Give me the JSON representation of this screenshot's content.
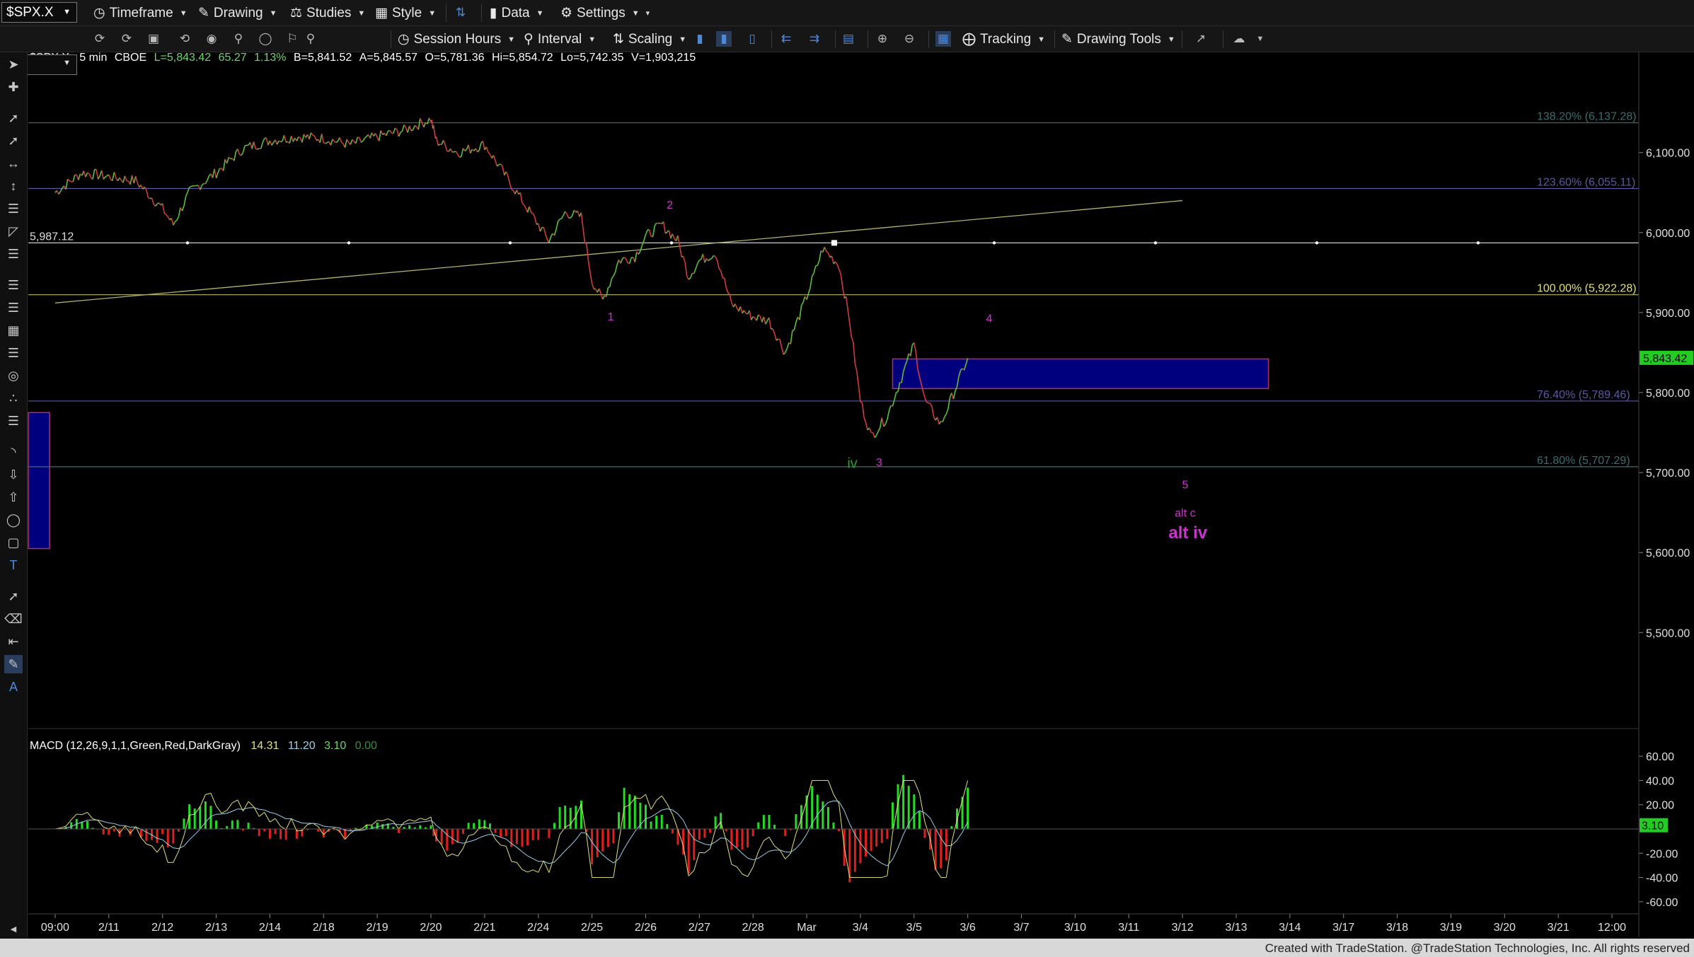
{
  "toolbar": {
    "symbol": "$SPX.X",
    "timeframe": "Timeframe",
    "drawing": "Drawing",
    "studies": "Studies",
    "style": "Style",
    "data": "Data",
    "settings": "Settings",
    "session_hours": "Session Hours",
    "interval": "Interval",
    "scaling": "Scaling",
    "tracking": "Tracking",
    "drawing_tools": "Drawing Tools"
  },
  "header": {
    "symbol_desc": "$SPX.X - 5 min",
    "exchange": "CBOE",
    "last": "L=5,843.42",
    "change": "65.27",
    "change_pct": "1.13%",
    "bid": "B=5,841.52",
    "ask": "A=5,845.57",
    "open": "O=5,781.36",
    "high": "Hi=5,854.72",
    "low": "Lo=5,742.35",
    "volume": "V=1,903,215"
  },
  "footer": "Created with TradeStation. @TradeStation Technologies, Inc. All rights reserved",
  "colors": {
    "up": "#5cbf3c",
    "down": "#d23b3b",
    "fib": "#5a5aa0",
    "accent": "#cc33cc",
    "current": "#22cc22",
    "box": "#00007f",
    "trend": "#b2b26b"
  },
  "chart_data": [
    {
      "type": "line",
      "title": "$SPX.X - 5 min",
      "x_tick_labels": [
        "09:00",
        "2/11",
        "2/12",
        "2/13",
        "2/14",
        "2/18",
        "2/19",
        "2/20",
        "2/21",
        "2/24",
        "2/25",
        "2/26",
        "2/27",
        "2/28",
        "Mar",
        "3/4",
        "3/5",
        "3/6",
        "3/7",
        "3/10",
        "3/11",
        "3/12",
        "3/13",
        "3/14",
        "3/17",
        "3/18",
        "3/19",
        "3/20",
        "3/21",
        "12:00"
      ],
      "y_tick_labels": [
        "6,100.00",
        "6,000.00",
        "5,900.00",
        "5,800.00",
        "5,700.00",
        "5,600.00",
        "5,500.00"
      ],
      "y_ticks": [
        6100,
        6000,
        5900,
        5800,
        5700,
        5600,
        5500
      ],
      "ylim": [
        5380,
        6220
      ],
      "series": [
        {
          "values": [
            {
              "x": 0.0,
              "y": 6050
            },
            {
              "x": 0.5,
              "y": 6075
            },
            {
              "x": 1.0,
              "y": 6070
            },
            {
              "x": 1.5,
              "y": 6065
            },
            {
              "x": 2.0,
              "y": 6030
            },
            {
              "x": 2.2,
              "y": 6010
            },
            {
              "x": 2.5,
              "y": 6050
            },
            {
              "x": 3.0,
              "y": 6075
            },
            {
              "x": 3.5,
              "y": 6105
            },
            {
              "x": 4.0,
              "y": 6115
            },
            {
              "x": 4.5,
              "y": 6120
            },
            {
              "x": 5.0,
              "y": 6118
            },
            {
              "x": 5.5,
              "y": 6110
            },
            {
              "x": 6.0,
              "y": 6120
            },
            {
              "x": 6.5,
              "y": 6128
            },
            {
              "x": 7.0,
              "y": 6142
            },
            {
              "x": 7.1,
              "y": 6115
            },
            {
              "x": 7.5,
              "y": 6100
            },
            {
              "x": 8.0,
              "y": 6110
            },
            {
              "x": 8.5,
              "y": 6060
            },
            {
              "x": 9.0,
              "y": 6010
            },
            {
              "x": 9.2,
              "y": 5990
            },
            {
              "x": 9.5,
              "y": 6025
            },
            {
              "x": 9.8,
              "y": 6020
            },
            {
              "x": 10.0,
              "y": 5940
            },
            {
              "x": 10.2,
              "y": 5915
            },
            {
              "x": 10.5,
              "y": 5965
            },
            {
              "x": 10.8,
              "y": 5970
            },
            {
              "x": 11.0,
              "y": 5995
            },
            {
              "x": 11.3,
              "y": 6010
            },
            {
              "x": 11.6,
              "y": 5990
            },
            {
              "x": 11.8,
              "y": 5945
            },
            {
              "x": 12.0,
              "y": 5965
            },
            {
              "x": 12.3,
              "y": 5975
            },
            {
              "x": 12.6,
              "y": 5910
            },
            {
              "x": 13.0,
              "y": 5895
            },
            {
              "x": 13.3,
              "y": 5890
            },
            {
              "x": 13.6,
              "y": 5850
            },
            {
              "x": 14.0,
              "y": 5920
            },
            {
              "x": 14.3,
              "y": 5980
            },
            {
              "x": 14.6,
              "y": 5960
            },
            {
              "x": 14.8,
              "y": 5890
            },
            {
              "x": 15.0,
              "y": 5790
            },
            {
              "x": 15.2,
              "y": 5745
            },
            {
              "x": 15.5,
              "y": 5770
            },
            {
              "x": 15.8,
              "y": 5825
            },
            {
              "x": 16.0,
              "y": 5860
            },
            {
              "x": 16.2,
              "y": 5790
            },
            {
              "x": 16.5,
              "y": 5760
            },
            {
              "x": 16.8,
              "y": 5810
            },
            {
              "x": 17.0,
              "y": 5843
            }
          ]
        }
      ],
      "horizontal_lines": [
        {
          "label": "138.20% (6,137.28)",
          "value": 6137.28,
          "color": "#3b6e6e"
        },
        {
          "label": "123.60% (6,055.11)",
          "value": 6055.11,
          "color": "#5a5aa0"
        },
        {
          "label": "5,987.12",
          "value": 5987.12,
          "color": "#cccccc"
        },
        {
          "label": "100.00% (5,922.28)",
          "value": 5922.28,
          "color": "#b8b870"
        },
        {
          "label": "76.40% (5,789.46)",
          "value": 5789.46,
          "color": "#5a5aa0"
        },
        {
          "label": "61.80% (5,707.29)",
          "value": 5707.29,
          "color": "#3b6e6e"
        }
      ],
      "trendline": {
        "x1": 0.0,
        "y1": 5912,
        "x2": 21.0,
        "y2": 6040
      },
      "target_box": {
        "x1": 15.6,
        "x2": 22.6,
        "y1": 5805,
        "y2": 5842
      },
      "wave_labels": [
        {
          "text": "1",
          "x": 10.35,
          "y": 5890,
          "color": "#cc33cc"
        },
        {
          "text": "2",
          "x": 11.45,
          "y": 6030,
          "color": "#cc33cc"
        },
        {
          "text": "iv",
          "x": 14.85,
          "y": 5706,
          "color": "#2e9e2e"
        },
        {
          "text": "3",
          "x": 15.35,
          "y": 5708,
          "color": "#cc33cc"
        },
        {
          "text": "4",
          "x": 17.4,
          "y": 5888,
          "color": "#cc33cc"
        },
        {
          "text": "5",
          "x": 21.05,
          "y": 5680,
          "color": "#cc33cc"
        },
        {
          "text": "alt c",
          "x": 21.05,
          "y": 5645,
          "color": "#cc33cc"
        },
        {
          "text": "alt iv",
          "x": 21.1,
          "y": 5618,
          "color": "#cc33cc"
        }
      ],
      "current_price": {
        "label": "5,843.42",
        "value": 5843.42
      }
    },
    {
      "type": "line",
      "title": "MACD (12,26,9,1,1,Green,Red,DarkGray)",
      "legend_values": [
        "14.31",
        "11.20",
        "3.10",
        "0.00"
      ],
      "y_tick_labels": [
        "60.00",
        "40.00",
        "20.00",
        "-20.00",
        "-40.00",
        "-60.00"
      ],
      "y_ticks": [
        60,
        40,
        20,
        -20,
        -40,
        -60
      ],
      "ylim": [
        -70,
        70
      ],
      "current_price": {
        "label": "3.10",
        "value": 3.1
      }
    }
  ]
}
